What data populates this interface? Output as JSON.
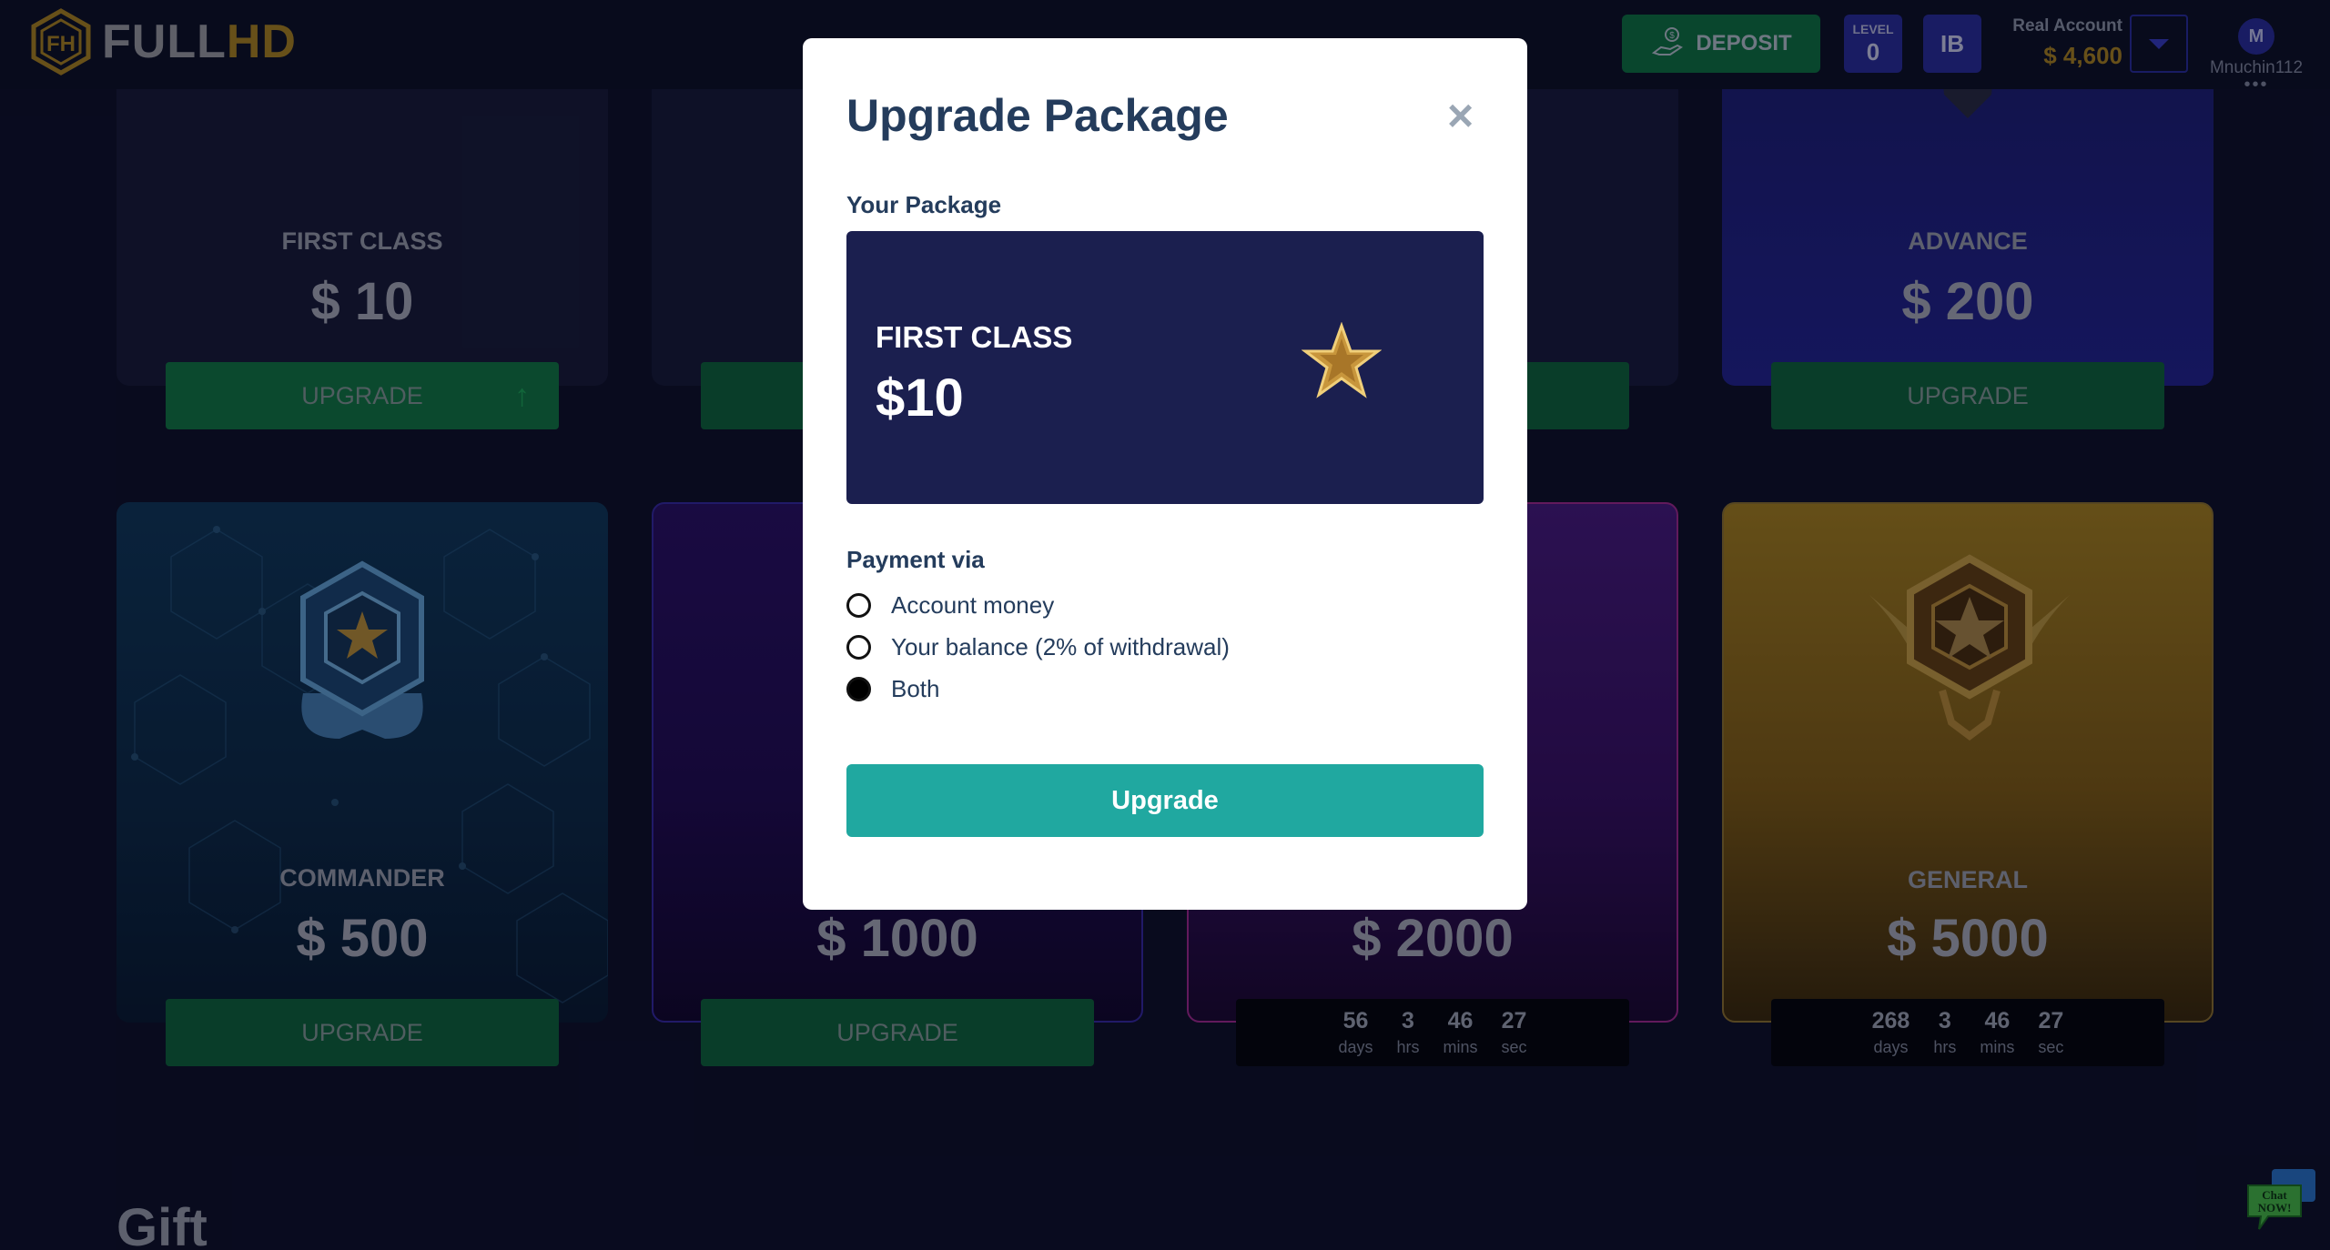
{
  "header": {
    "logo_full": "FULL",
    "logo_hd": "HD",
    "deposit_label": "DEPOSIT",
    "level_caption": "LEVEL",
    "level_value": "0",
    "ib_label": "IB",
    "account_type": "Real Account",
    "account_balance": "$ 4,600",
    "avatar_initial": "M",
    "username": "Mnuchin112",
    "more_dots": "•••"
  },
  "packages": [
    {
      "name": "FIRST CLASS",
      "price": "$ 10",
      "button": "UPGRADE",
      "arrow": "↑"
    },
    {
      "name": "",
      "price": "",
      "button": ""
    },
    {
      "name": "",
      "price": "",
      "button": ""
    },
    {
      "name": "ADVANCE",
      "price": "$ 200",
      "button": "UPGRADE"
    },
    {
      "name": "COMMANDER",
      "price": "$ 500",
      "button": "UPGRADE"
    },
    {
      "name": "",
      "price": "$ 1000",
      "button": "UPGRADE"
    },
    {
      "name": "",
      "price": "$ 2000",
      "timer": {
        "days": "56",
        "hrs": "3",
        "mins": "46",
        "sec": "27"
      }
    },
    {
      "name": "GENERAL",
      "price": "$ 5000",
      "timer": {
        "days": "268",
        "hrs": "3",
        "mins": "46",
        "sec": "27"
      }
    }
  ],
  "timer_units": {
    "days": "days",
    "hrs": "hrs",
    "mins": "mins",
    "sec": "sec"
  },
  "gift_heading": "Gift",
  "chat": {
    "line1": "Chat",
    "line2": "NOW!"
  },
  "modal": {
    "title": "Upgrade Package",
    "close": "×",
    "your_package_label": "Your Package",
    "package_name": "FIRST CLASS",
    "package_price": "$10",
    "payment_via_label": "Payment via",
    "payment_options": [
      {
        "label": "Account money",
        "checked": false
      },
      {
        "label": "Your balance (2% of withdrawal)",
        "checked": false
      },
      {
        "label": "Both",
        "checked": true
      }
    ],
    "upgrade_button": "Upgrade"
  },
  "colors": {
    "background": "#0d1029",
    "deposit_green": "#0d7a44",
    "brand_gold": "#b98d20",
    "level_blue": "#2b2ea6",
    "modal_primary": "#20a8a0",
    "modal_text": "#243c5c"
  }
}
